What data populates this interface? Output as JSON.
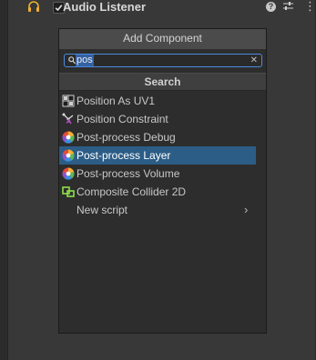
{
  "component_header": {
    "title": "Audio Listener",
    "enabled": true,
    "help_icon": "help-icon",
    "presets_icon": "presets-icon",
    "menu_icon": "kebab-menu-icon"
  },
  "popup": {
    "title": "Add Component",
    "search": {
      "value": "pos",
      "placeholder": ""
    },
    "section_header": "Search",
    "items": [
      {
        "label": "Position As UV1",
        "icon": "uv-grid-icon"
      },
      {
        "label": "Position Constraint",
        "icon": "constraint-icon"
      },
      {
        "label": "Post-process Debug",
        "icon": "post-process-icon"
      },
      {
        "label": "Post-process Layer",
        "icon": "post-process-icon",
        "selected": true
      },
      {
        "label": "Post-process Volume",
        "icon": "post-process-icon"
      },
      {
        "label": "Composite Collider 2D",
        "icon": "collider-2d-icon"
      },
      {
        "label": "New script",
        "icon": "",
        "submenu": true
      }
    ]
  },
  "colors": {
    "panel_bg": "#383838",
    "popup_bg": "#2d2d2d",
    "selection": "#2c5d87",
    "search_focus": "#4d8adb"
  }
}
